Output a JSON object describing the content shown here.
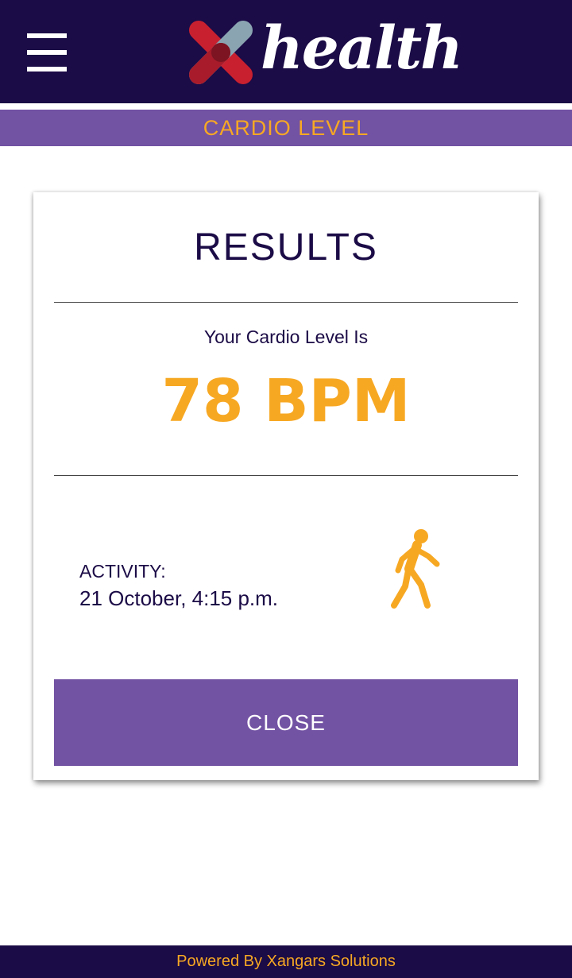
{
  "header": {
    "logo_text": "health",
    "menu_icon": "hamburger-menu-icon"
  },
  "section": {
    "title": "CARDIO LEVEL"
  },
  "card": {
    "title": "RESULTS",
    "result_label": "Your Cardio Level Is",
    "result_value": "78 BPM",
    "activity_label": "ACTIVITY:",
    "activity_time": "21 October, 4:15 p.m.",
    "activity_icon": "walking-person-icon",
    "close_label": "CLOSE"
  },
  "footer": {
    "text": "Powered By Xangars Solutions"
  },
  "colors": {
    "header_bg": "#1b0b46",
    "accent_purple": "#7252a3",
    "accent_orange": "#f7a823",
    "logo_red": "#c8202f",
    "logo_gray": "#8aa4b1"
  }
}
